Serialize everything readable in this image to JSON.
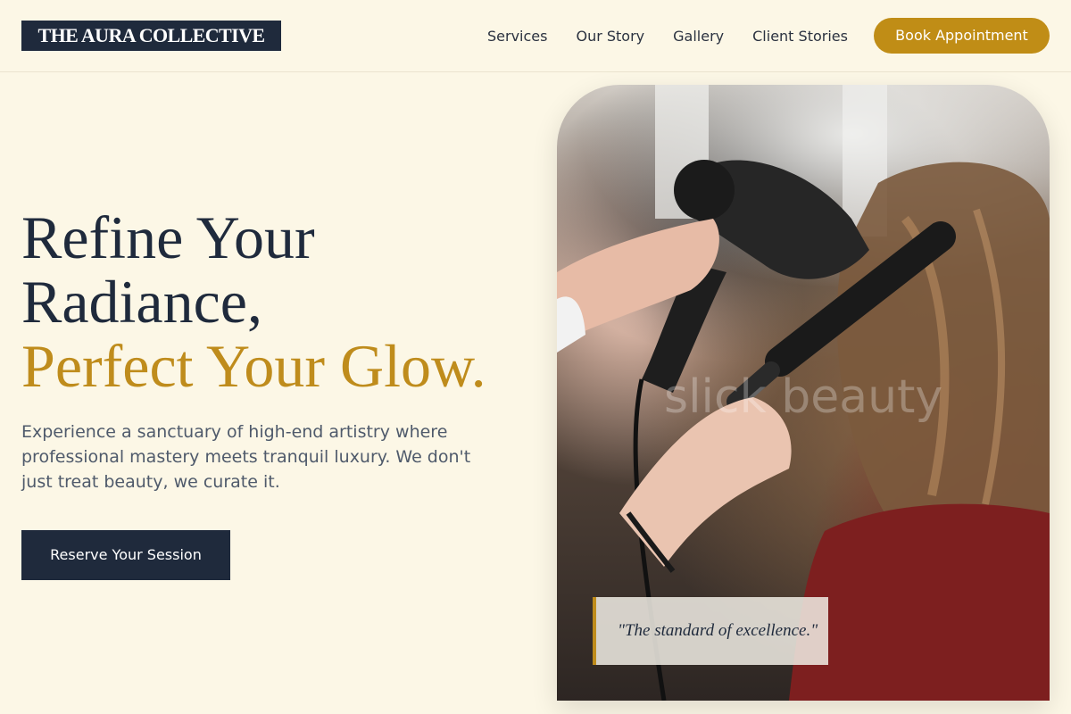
{
  "header": {
    "logo_text": "THE AURA COLLECTIVE",
    "nav": [
      {
        "label": "Services"
      },
      {
        "label": "Our Story"
      },
      {
        "label": "Gallery"
      },
      {
        "label": "Client Stories"
      }
    ],
    "book_label": "Book Appointment"
  },
  "hero": {
    "title_line1": "Refine Your",
    "title_line2": "Radiance,",
    "title_accent": "Perfect Your Glow.",
    "description": "Experience a sanctuary of high-end artistry where professional mastery meets tranquil luxury. We don't just treat beauty, we curate it.",
    "cta_label": "Reserve Your Session",
    "image_subject": "stylist blow-drying client's long wavy hair with round brush",
    "watermark_text": "slick beauty",
    "quote": "\"The standard of excellence.\""
  },
  "colors": {
    "background": "#fcf7e6",
    "navy": "#1f2a3c",
    "gold": "#bf8c1c",
    "button_gold": "#c08d16",
    "body_text": "#4f5a6b"
  }
}
